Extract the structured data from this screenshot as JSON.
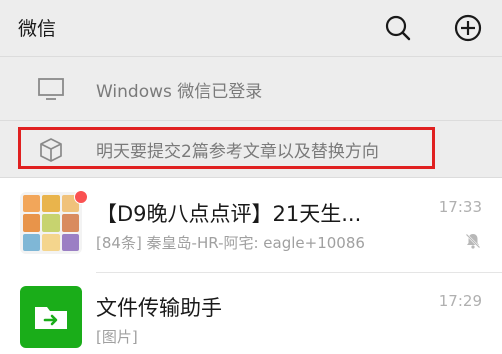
{
  "header": {
    "title": "微信",
    "search_icon": "search-icon",
    "add_icon": "plus-circle-icon"
  },
  "notices": [
    {
      "icon": "monitor-icon",
      "text": "Windows 微信已登录"
    },
    {
      "icon": "cube-icon",
      "text": "明天要提交2篇参考文章以及替换方向"
    }
  ],
  "chats": [
    {
      "name": "【D9晚八点点评】21天生...",
      "preview": "[84条] 秦皇岛-HR-阿宅: eagle+10086",
      "time": "17:33",
      "muted": true,
      "has_unread_dot": true
    },
    {
      "name": "文件传输助手",
      "preview": "[图片]",
      "time": "17:29",
      "muted": false
    }
  ],
  "colors": {
    "highlight": "#e02020",
    "unread": "#fa5151",
    "file_transfer": "#1aad19"
  }
}
